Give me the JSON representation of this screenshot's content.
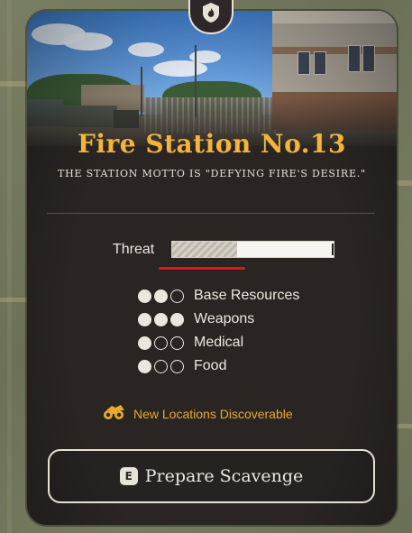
{
  "location": {
    "title": "Fire Station No.13",
    "motto": "THE STATION MOTTO IS \"DEFYING FIRE'S DESIRE.\"",
    "badge_icon": "fire-badge-icon"
  },
  "threat": {
    "label": "Threat",
    "level": 0.4,
    "highlight_color": "#e01818"
  },
  "resources": [
    {
      "label": "Base Resources",
      "filled": 2,
      "total": 3
    },
    {
      "label": "Weapons",
      "filled": 3,
      "total": 3
    },
    {
      "label": "Medical",
      "filled": 1,
      "total": 3
    },
    {
      "label": "Food",
      "filled": 1,
      "total": 3
    }
  ],
  "discoverable": {
    "icon": "binoculars-icon",
    "text": "New Locations Discoverable"
  },
  "action": {
    "key": "E",
    "label": "Prepare Scavenge"
  },
  "colors": {
    "title": "#f2b43a",
    "accent": "#e9aa2c",
    "panel": "#2a2523",
    "text": "#ece7de"
  }
}
